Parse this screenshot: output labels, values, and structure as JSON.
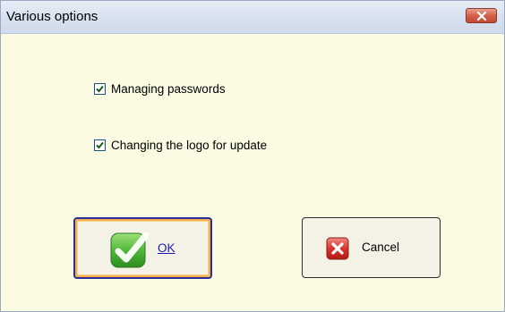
{
  "window": {
    "title": "Various options",
    "close_icon": "close-icon"
  },
  "options": [
    {
      "label": "Managing passwords",
      "checked": true
    },
    {
      "label": "Changing the logo for update",
      "checked": true
    }
  ],
  "buttons": {
    "ok_label": "OK",
    "ok_icon": "checkmark-icon",
    "cancel_label": "Cancel",
    "cancel_icon": "red-x-icon"
  },
  "colors": {
    "dialog_background": "#fbfbe3",
    "focus_border": "#2a2d9a",
    "focus_highlight": "#f3b04a",
    "ok_link": "#1b1bb0",
    "close_button": "#d4614a"
  }
}
